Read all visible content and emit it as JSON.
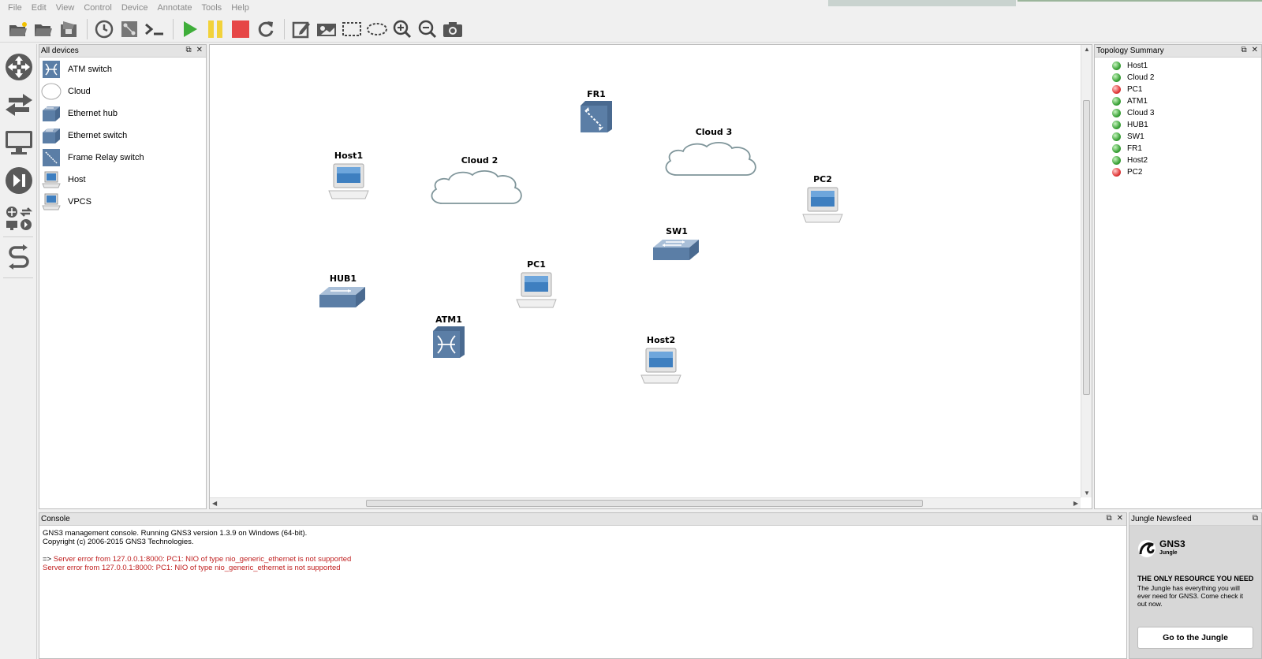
{
  "menu": [
    "File",
    "Edit",
    "View",
    "Control",
    "Device",
    "Annotate",
    "Tools",
    "Help"
  ],
  "toolbar": {
    "buttons": [
      "open-project",
      "open-folder",
      "save-project",
      "snapshot-clock",
      "device-list",
      "console-prompt",
      "start-all",
      "suspend-all",
      "stop-all",
      "reload-all",
      "add-note",
      "insert-picture",
      "draw-rectangle",
      "draw-ellipse",
      "zoom-in",
      "zoom-out",
      "screenshot"
    ],
    "colors": {
      "start": "#3fae3a",
      "suspend": "#f2d23a",
      "stop": "#e64646"
    }
  },
  "devices_panel": {
    "title": "All devices",
    "items": [
      {
        "label": "ATM switch",
        "icon": "atm-switch-icon"
      },
      {
        "label": "Cloud",
        "icon": "cloud-icon"
      },
      {
        "label": "Ethernet hub",
        "icon": "ethernet-hub-icon"
      },
      {
        "label": "Ethernet switch",
        "icon": "ethernet-switch-icon"
      },
      {
        "label": "Frame Relay switch",
        "icon": "frame-relay-icon"
      },
      {
        "label": "Host",
        "icon": "host-icon"
      },
      {
        "label": "VPCS",
        "icon": "vpcs-icon"
      }
    ]
  },
  "canvas": {
    "nodes": [
      {
        "label": "FR1",
        "type": "frame-relay"
      },
      {
        "label": "Cloud 3",
        "type": "cloud"
      },
      {
        "label": "Host1",
        "type": "host"
      },
      {
        "label": "Cloud 2",
        "type": "cloud"
      },
      {
        "label": "PC2",
        "type": "host"
      },
      {
        "label": "SW1",
        "type": "switch"
      },
      {
        "label": "PC1",
        "type": "host"
      },
      {
        "label": "HUB1",
        "type": "hub"
      },
      {
        "label": "ATM1",
        "type": "atm"
      },
      {
        "label": "Host2",
        "type": "host"
      }
    ]
  },
  "topology": {
    "title": "Topology Summary",
    "items": [
      {
        "label": "Host1",
        "status": "green"
      },
      {
        "label": "Cloud 2",
        "status": "green"
      },
      {
        "label": "PC1",
        "status": "red"
      },
      {
        "label": "ATM1",
        "status": "green"
      },
      {
        "label": "Cloud 3",
        "status": "green"
      },
      {
        "label": "HUB1",
        "status": "green"
      },
      {
        "label": "SW1",
        "status": "green"
      },
      {
        "label": "FR1",
        "status": "green"
      },
      {
        "label": "Host2",
        "status": "green"
      },
      {
        "label": "PC2",
        "status": "red"
      }
    ]
  },
  "console": {
    "title": "Console",
    "lines": [
      "GNS3 management console. Running GNS3 version 1.3.9 on Windows (64-bit).",
      "Copyright (c) 2006-2015 GNS3 Technologies."
    ],
    "prompt": "=>",
    "errors": [
      "Server error from 127.0.0.1:8000: PC1: NIO of type nio_generic_ethernet is not supported",
      "Server error from 127.0.0.1:8000: PC1: NIO of type nio_generic_ethernet is not supported"
    ]
  },
  "jungle": {
    "title": "Jungle Newsfeed",
    "brand": "GNS3",
    "brand_sub": "Jungle",
    "headline": "THE ONLY RESOURCE YOU NEED",
    "text": "The Jungle has everything you will ever need for GNS3. Come check it out now.",
    "button": "Go to the Jungle"
  }
}
